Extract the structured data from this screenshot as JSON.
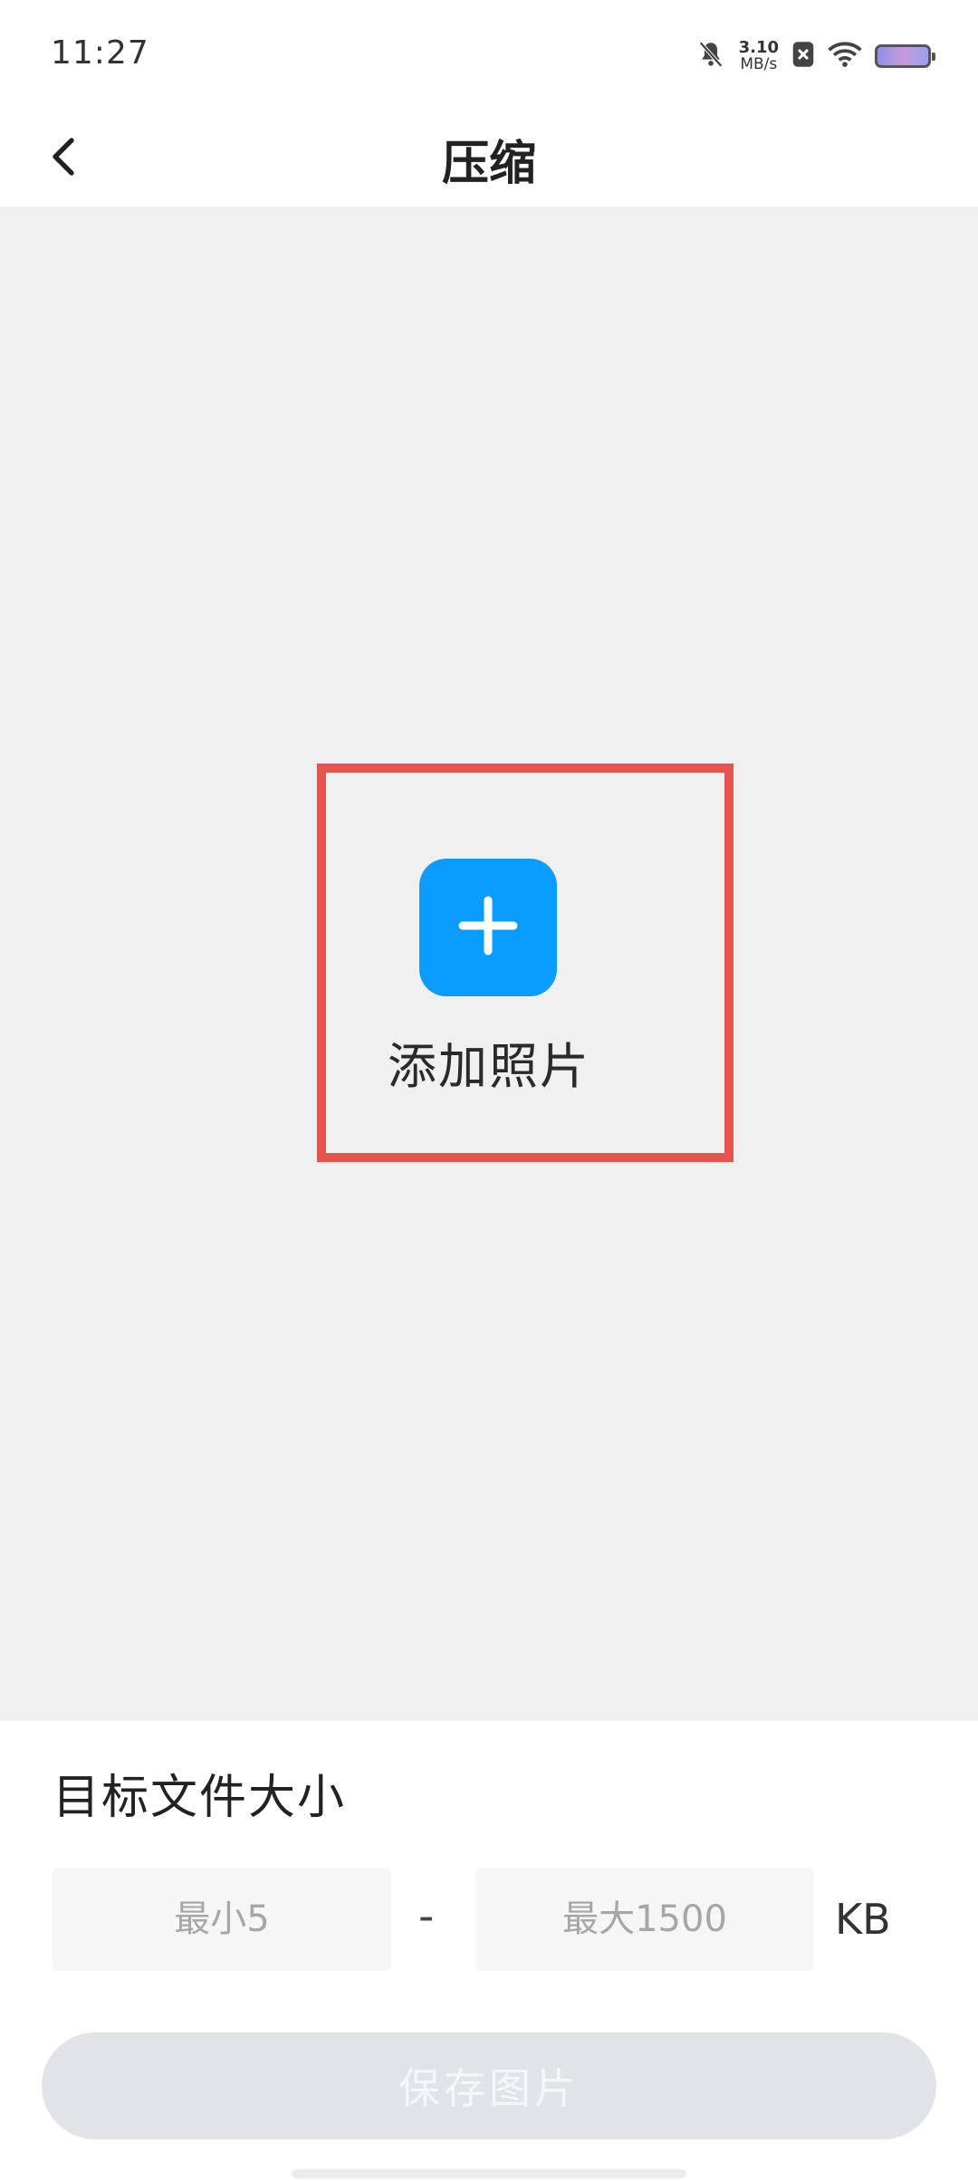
{
  "status_bar": {
    "time": "11:27",
    "net_speed_value": "3.10",
    "net_speed_unit": "MB/s",
    "icons": [
      "bell-muted-icon",
      "sim-blocked-icon",
      "wifi-icon",
      "battery-icon"
    ]
  },
  "header": {
    "title": "压缩",
    "back_icon": "chevron-left-icon"
  },
  "main": {
    "add_photo_label": "添加照片",
    "add_icon": "plus-icon",
    "accent_color": "#0a9cff",
    "highlight_color": "#e8534f"
  },
  "settings": {
    "target_label": "目标文件大小",
    "min_placeholder": "最小5",
    "max_placeholder": "最大1500",
    "separator": "-",
    "unit": "KB",
    "save_label": "保存图片"
  }
}
